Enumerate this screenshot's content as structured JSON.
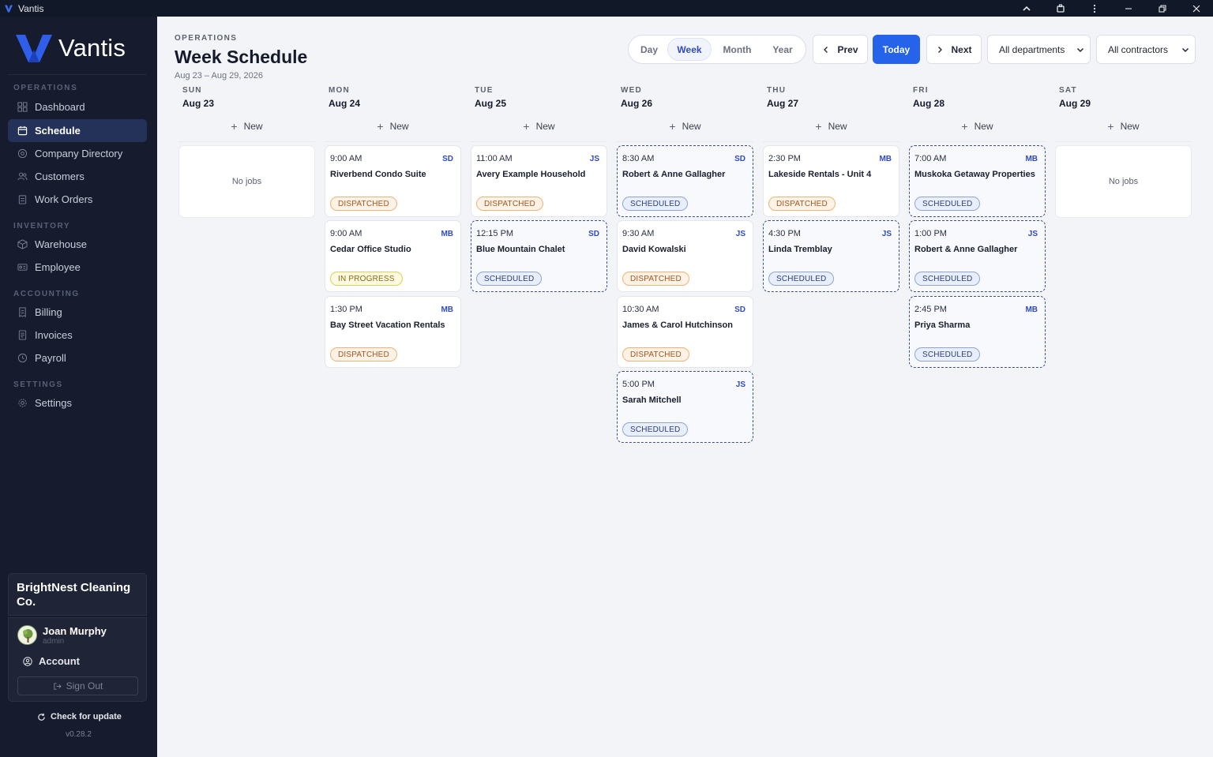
{
  "window": {
    "title": "Vantis"
  },
  "sidebar": {
    "brand": "Vantis",
    "sections": {
      "operations": "OPERATIONS",
      "inventory": "INVENTORY",
      "accounting": "ACCOUNTING",
      "settings": "SETTINGS"
    },
    "items": [
      {
        "label": "Dashboard",
        "icon": "grid-icon"
      },
      {
        "label": "Schedule",
        "icon": "calendar-icon",
        "active": true
      },
      {
        "label": "Company Directory",
        "icon": "building-icon"
      },
      {
        "label": "Customers",
        "icon": "users-icon"
      },
      {
        "label": "Work Orders",
        "icon": "clipboard-icon"
      },
      {
        "label": "Warehouse",
        "icon": "box-icon"
      },
      {
        "label": "Employee",
        "icon": "id-card-icon"
      },
      {
        "label": "Billing",
        "icon": "receipt-icon"
      },
      {
        "label": "Invoices",
        "icon": "document-icon"
      },
      {
        "label": "Payroll",
        "icon": "clock-icon"
      },
      {
        "label": "Settings",
        "icon": "gear-icon"
      }
    ],
    "org_name": "BrightNest Cleaning Co.",
    "user": {
      "name": "Joan Murphy",
      "role": "admin"
    },
    "account_label": "Account",
    "signout_label": "Sign Out",
    "update_label": "Check for update",
    "version": "v0.28.2"
  },
  "header": {
    "eyebrow": "OPERATIONS",
    "title": "Week Schedule",
    "date_range": "Aug 23 – Aug 29, 2026",
    "views": [
      "Day",
      "Week",
      "Month",
      "Year"
    ],
    "active_view": "Week",
    "prev_label": "Prev",
    "today_label": "Today",
    "next_label": "Next",
    "department_filter": "All departments",
    "contractor_filter": "All contractors"
  },
  "new_label": "New",
  "no_jobs_label": "No jobs",
  "colors": {
    "accent": "#2563eb",
    "sidebar_bg": "#161b2e",
    "dispatched": "#a8541c",
    "in_progress": "#8a6a08",
    "scheduled": "#283f80"
  },
  "days": [
    {
      "name": "SUN",
      "date": "Aug 23",
      "jobs": []
    },
    {
      "name": "MON",
      "date": "Aug 24",
      "jobs": [
        {
          "time": "9:00 AM",
          "badge": "SD",
          "title": "Riverbend Condo Suite",
          "status": "DISPATCHED"
        },
        {
          "time": "9:00 AM",
          "badge": "MB",
          "title": "Cedar Office Studio",
          "status": "IN PROGRESS"
        },
        {
          "time": "1:30 PM",
          "badge": "MB",
          "title": "Bay Street Vacation Rentals",
          "status": "DISPATCHED"
        }
      ]
    },
    {
      "name": "TUE",
      "date": "Aug 25",
      "jobs": [
        {
          "time": "11:00 AM",
          "badge": "JS",
          "title": "Avery Example Household",
          "status": "DISPATCHED"
        },
        {
          "time": "12:15 PM",
          "badge": "SD",
          "title": "Blue Mountain Chalet",
          "status": "SCHEDULED"
        }
      ]
    },
    {
      "name": "WED",
      "date": "Aug 26",
      "jobs": [
        {
          "time": "8:30 AM",
          "badge": "SD",
          "title": "Robert & Anne Gallagher",
          "status": "SCHEDULED"
        },
        {
          "time": "9:30 AM",
          "badge": "JS",
          "title": "David Kowalski",
          "status": "DISPATCHED"
        },
        {
          "time": "10:30 AM",
          "badge": "SD",
          "title": "James & Carol Hutchinson",
          "status": "DISPATCHED"
        },
        {
          "time": "5:00 PM",
          "badge": "JS",
          "title": "Sarah Mitchell",
          "status": "SCHEDULED"
        }
      ]
    },
    {
      "name": "THU",
      "date": "Aug 27",
      "jobs": [
        {
          "time": "2:30 PM",
          "badge": "MB",
          "title": "Lakeside Rentals - Unit 4",
          "status": "DISPATCHED"
        },
        {
          "time": "4:30 PM",
          "badge": "JS",
          "title": "Linda Tremblay",
          "status": "SCHEDULED"
        }
      ]
    },
    {
      "name": "FRI",
      "date": "Aug 28",
      "jobs": [
        {
          "time": "7:00 AM",
          "badge": "MB",
          "title": "Muskoka Getaway Properties",
          "status": "SCHEDULED"
        },
        {
          "time": "1:00 PM",
          "badge": "JS",
          "title": "Robert & Anne Gallagher",
          "status": "SCHEDULED"
        },
        {
          "time": "2:45 PM",
          "badge": "MB",
          "title": "Priya Sharma",
          "status": "SCHEDULED"
        }
      ]
    },
    {
      "name": "SAT",
      "date": "Aug 29",
      "jobs": []
    }
  ]
}
